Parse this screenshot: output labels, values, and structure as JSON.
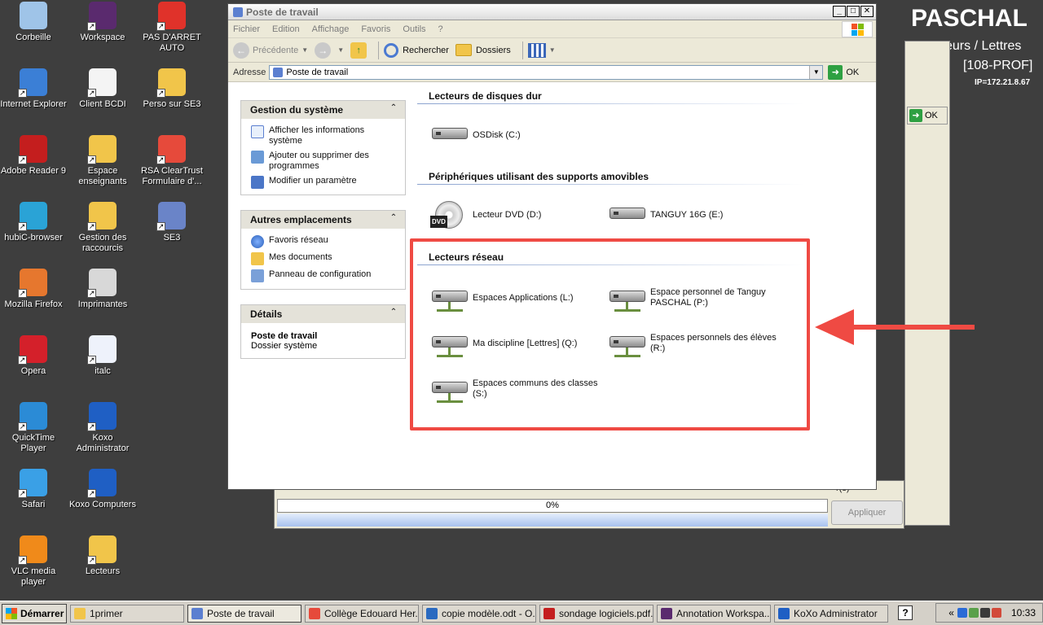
{
  "desktop": {
    "icons": [
      {
        "label": "Corbeille"
      },
      {
        "label": "Workspace"
      },
      {
        "label": "PAS D'ARRET AUTO"
      },
      {
        "label": "Internet Explorer"
      },
      {
        "label": "Client BCDI"
      },
      {
        "label": "Perso sur SE3"
      },
      {
        "label": "Adobe Reader 9"
      },
      {
        "label": "Espace enseignants"
      },
      {
        "label": "RSA ClearTrust Formulaire d'..."
      },
      {
        "label": "hubiC-browser"
      },
      {
        "label": "Gestion des raccourcis"
      },
      {
        "label": "SE3"
      },
      {
        "label": "Mozilla Firefox"
      },
      {
        "label": "Imprimantes"
      },
      {
        "label": "Opera"
      },
      {
        "label": "italc"
      },
      {
        "label": "QuickTime Player"
      },
      {
        "label": "Koxo Administrator"
      },
      {
        "label": "Safari"
      },
      {
        "label": "Koxo Computers"
      },
      {
        "label": "VLC media player"
      },
      {
        "label": "Lecteurs"
      }
    ]
  },
  "background_window": {
    "name": "PASCHAL",
    "subtitle": "eurs / Lettres",
    "subtitle2": "[108-PROF]",
    "ip": "IP=172.21.8.67",
    "ok_label": "OK",
    "progress": "0%",
    "apply_label": "Appliquer",
    "users_label": "r(s)"
  },
  "explorer": {
    "title": "Poste de travail",
    "menu": [
      "Fichier",
      "Edition",
      "Affichage",
      "Favoris",
      "Outils",
      "?"
    ],
    "toolbar": {
      "back": "Précédente",
      "search": "Rechercher",
      "folders": "Dossiers"
    },
    "address": {
      "label": "Adresse",
      "value": "Poste de travail",
      "go": "OK"
    },
    "panes": {
      "system": {
        "title": "Gestion du système",
        "items": [
          "Afficher les informations système",
          "Ajouter ou supprimer des programmes",
          "Modifier un paramètre"
        ]
      },
      "places": {
        "title": "Autres emplacements",
        "items": [
          "Favoris réseau",
          "Mes documents",
          "Panneau de configuration"
        ]
      },
      "details": {
        "title": "Détails",
        "name": "Poste de travail",
        "type": "Dossier système"
      }
    },
    "groups": {
      "hard_disks": {
        "title": "Lecteurs de disques dur",
        "drives": [
          "OSDisk (C:)"
        ]
      },
      "removable": {
        "title": "Périphériques utilisant des supports amovibles",
        "drives": [
          "Lecteur DVD (D:)",
          "TANGUY 16G (E:)"
        ]
      },
      "network": {
        "title": "Lecteurs réseau",
        "drives": [
          "Espaces Applications (L:)",
          "Espace personnel de Tanguy PASCHAL (P:)",
          "Ma discipline [Lettres] (Q:)",
          "Espaces personnels des élèves (R:)",
          "Espaces communs des classes (S:)"
        ]
      }
    }
  },
  "taskbar": {
    "start": "Démarrer",
    "tasks": [
      "1primer",
      "Poste de travail",
      "Collège Edouard Her...",
      "copie modèle.odt - O...",
      "sondage logiciels.pdf...",
      "Annotation Workspa...",
      "KoXo Administrator"
    ],
    "clock": "10:33",
    "chevron": "«"
  },
  "colors": {
    "highlight_red": "#ef4a43",
    "pane_header": "#e4e2d9",
    "desktop": "#3e3e3e"
  }
}
